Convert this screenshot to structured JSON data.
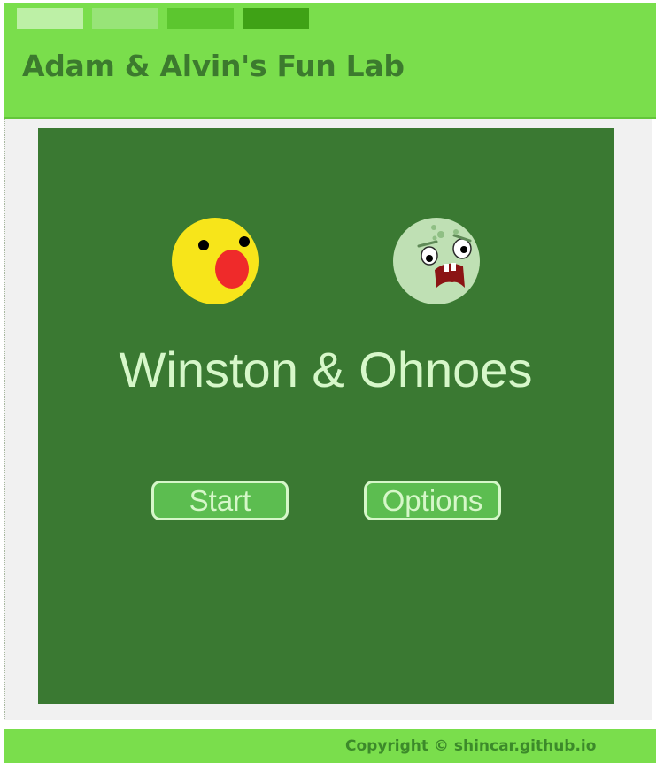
{
  "header": {
    "title": "Adam & Alvin's Fun Lab",
    "swatch_colors": [
      "#bdf0a6",
      "#98e478",
      "#5cc62f",
      "#3fa216"
    ]
  },
  "game": {
    "title": "Winston & Ohnoes",
    "start_label": "Start",
    "options_label": "Options",
    "characters": [
      "winston-face-icon",
      "ohnoes-face-icon"
    ]
  },
  "footer": {
    "copyright": "Copyright © shincar.github.io"
  },
  "colors": {
    "canvas_bg": "#3a7932",
    "title_text": "#d6f7c9",
    "button_bg": "#5cbd50",
    "header_text": "#3c7a2e",
    "footer_text": "#3c8a2a",
    "stage_bg": "#f1f1f1",
    "winston_yellow": "#f7e51a",
    "winston_mouth": "#ef2a2a",
    "ohnoes_green": "#bfe0b4"
  }
}
